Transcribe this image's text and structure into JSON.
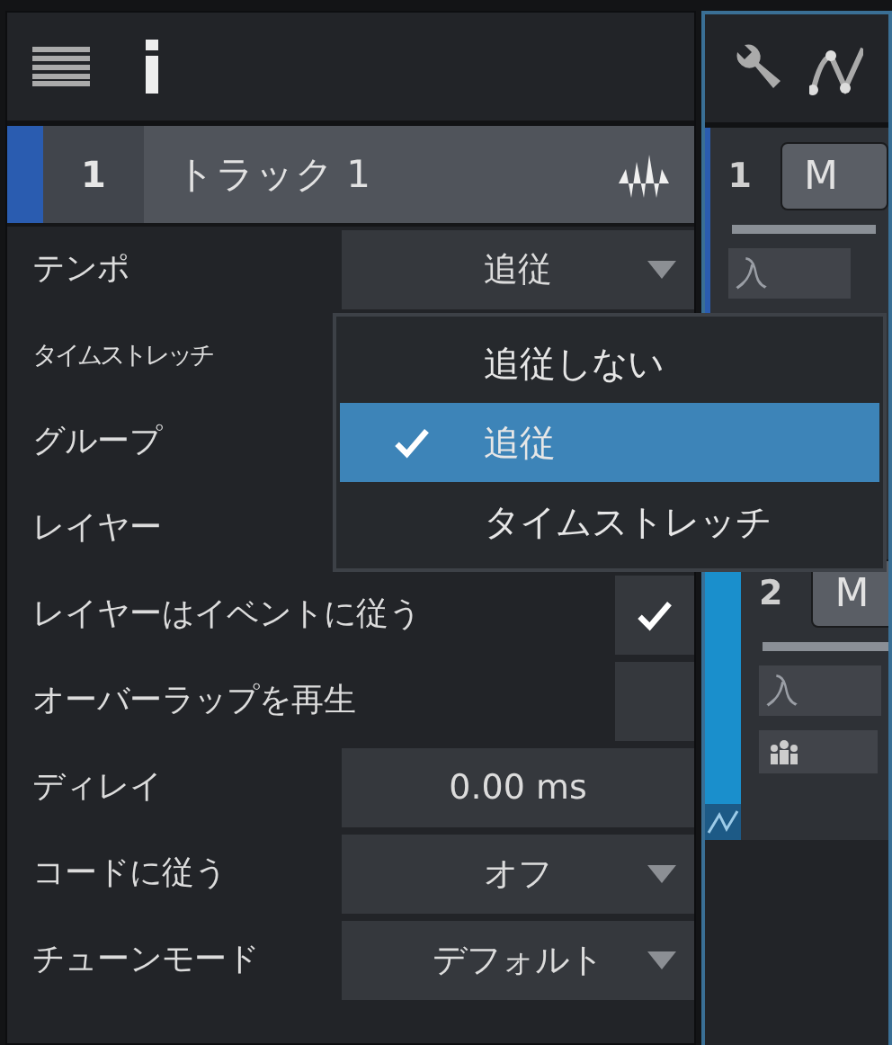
{
  "track": {
    "number": "1",
    "name": "トラック 1",
    "color": "#2a5cb0"
  },
  "properties": [
    {
      "kind": "select",
      "label": "テンポ",
      "value": "追従"
    },
    {
      "kind": "plain",
      "label": "タイムストレッチ",
      "condensed": true
    },
    {
      "kind": "plain",
      "label": "グループ"
    },
    {
      "kind": "plain",
      "label": "レイヤー"
    },
    {
      "kind": "checkbox",
      "label": "レイヤーはイベントに従う",
      "checked": true
    },
    {
      "kind": "checkbox",
      "label": "オーバーラップを再生",
      "checked": false
    },
    {
      "kind": "field",
      "label": "ディレイ",
      "value": "0.00 ms"
    },
    {
      "kind": "select",
      "label": "コードに従う",
      "value": "オフ"
    },
    {
      "kind": "select",
      "label": "チューンモード",
      "value": "デフォルト"
    }
  ],
  "dropdown": {
    "options": [
      {
        "label": "追従しない",
        "selected": false
      },
      {
        "label": "追従",
        "selected": true
      },
      {
        "label": "タイムストレッチ",
        "selected": false
      }
    ]
  },
  "mixer_tracks": [
    {
      "number": "1",
      "mute": "M",
      "input": "入",
      "color": "#2a5cb0"
    },
    {
      "number": "2",
      "mute": "M",
      "input": "入",
      "color": "#1a8fcc",
      "mixer_icon": true
    }
  ]
}
